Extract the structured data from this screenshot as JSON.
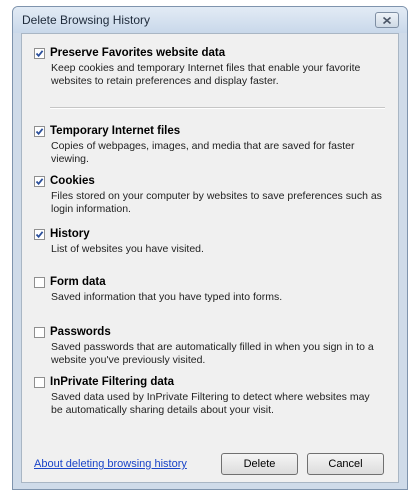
{
  "window": {
    "title": "Delete Browsing History",
    "close_icon": "close-icon"
  },
  "options": [
    {
      "id": "preserve-favorites",
      "label": "Preserve Favorites website data",
      "checked": true,
      "description": "Keep cookies and temporary Internet files that enable your favorite websites to retain preferences and display faster."
    },
    {
      "id": "temporary-internet-files",
      "label": "Temporary Internet files",
      "checked": true,
      "description": "Copies of webpages, images, and media that are saved for faster viewing."
    },
    {
      "id": "cookies",
      "label": "Cookies",
      "checked": true,
      "description": "Files stored on your computer by websites to save preferences such as login information."
    },
    {
      "id": "history",
      "label": "History",
      "checked": true,
      "description": "List of websites you have visited."
    },
    {
      "id": "form-data",
      "label": "Form data",
      "checked": false,
      "description": "Saved information that you have typed into forms."
    },
    {
      "id": "passwords",
      "label": "Passwords",
      "checked": false,
      "description": "Saved passwords that are automatically filled in when you sign in to a website you've previously visited."
    },
    {
      "id": "inprivate-filtering",
      "label": "InPrivate Filtering data",
      "checked": false,
      "description": "Saved data used by InPrivate Filtering to detect where websites may be automatically sharing details about your visit."
    }
  ],
  "footer": {
    "link": "About deleting browsing history",
    "delete_label": "Delete",
    "cancel_label": "Cancel"
  },
  "colors": {
    "checkmark": "#2b4f9b",
    "link": "#1a44c8"
  }
}
